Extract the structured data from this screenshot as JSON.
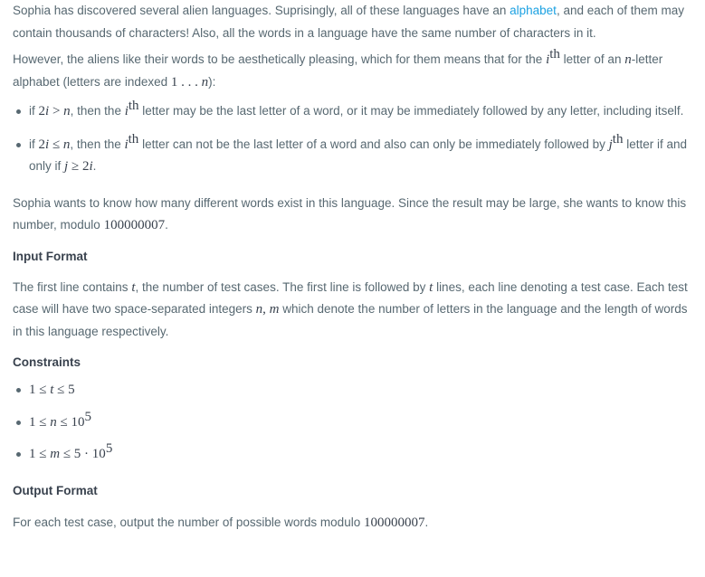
{
  "intro": {
    "text_1": "Sophia has discovered several alien languages. Suprisingly, all of these languages have an ",
    "link": "alphabet",
    "text_2": ", and each of them may contain thousands of characters! Also, all the words in a language have the same number of characters in it."
  },
  "however": {
    "text_1": "However, the aliens like their words to be aesthetically pleasing, which for them means that for the ",
    "i": "i",
    "th": "th",
    "text_2": " letter of an ",
    "n": "n",
    "text_3": "-letter alphabet (letters are indexed ",
    "range_1": "1",
    "range_dots": " . . . ",
    "range_n": "n",
    "text_4": "):"
  },
  "rules": [
    {
      "prefix": "if ",
      "cond_coef": "2",
      "cond_var": "i",
      "cond_op": " > ",
      "cond_n": "n",
      "text_1": ", then the ",
      "i": "i",
      "th": "th",
      "text_2": " letter may be the last letter of a word, or it may be immediately followed by any letter, including itself."
    },
    {
      "prefix": "if ",
      "cond_coef": "2",
      "cond_var": "i",
      "cond_op": " ≤ ",
      "cond_n": "n",
      "text_1": ", then the ",
      "i": "i",
      "th": "th",
      "text_2": " letter can not be the last letter of a word and also can only be immediately followed by ",
      "j": "j",
      "jth": "th",
      "text_3": " letter if and only if ",
      "jj": "j",
      "jop": " ≥ ",
      "jcoef": "2",
      "jvar": "i",
      "end": "."
    }
  ],
  "sophia": {
    "text_1": "Sophia wants to know how many different words exist in this language. Since the result may be large, she wants to know this number, modulo ",
    "mod": "100000007",
    "end": "."
  },
  "input_format": {
    "heading": "Input Format",
    "text_1": "The first line contains ",
    "t": "t",
    "text_2": ", the number of test cases. The first line is followed by ",
    "t2": "t",
    "text_3": " lines, each line denoting a test case. Each test case will have two space-separated integers ",
    "n": "n",
    "comma": ", ",
    "m": "m",
    "text_4": " which denote the number of letters in the language and the length of words in this language respectively."
  },
  "constraints": {
    "heading": "Constraints",
    "items": [
      {
        "a": "1 ≤ ",
        "v": "t",
        "b": " ≤ 5"
      },
      {
        "a": "1 ≤ ",
        "v": "n",
        "b": " ≤ 10",
        "sup": "5"
      },
      {
        "a": "1 ≤ ",
        "v": "m",
        "b": " ≤ 5 · 10",
        "sup": "5"
      }
    ]
  },
  "output_format": {
    "heading": "Output Format",
    "text_1": "For each test case, output the number of possible words modulo ",
    "mod": "100000007",
    "end": "."
  }
}
